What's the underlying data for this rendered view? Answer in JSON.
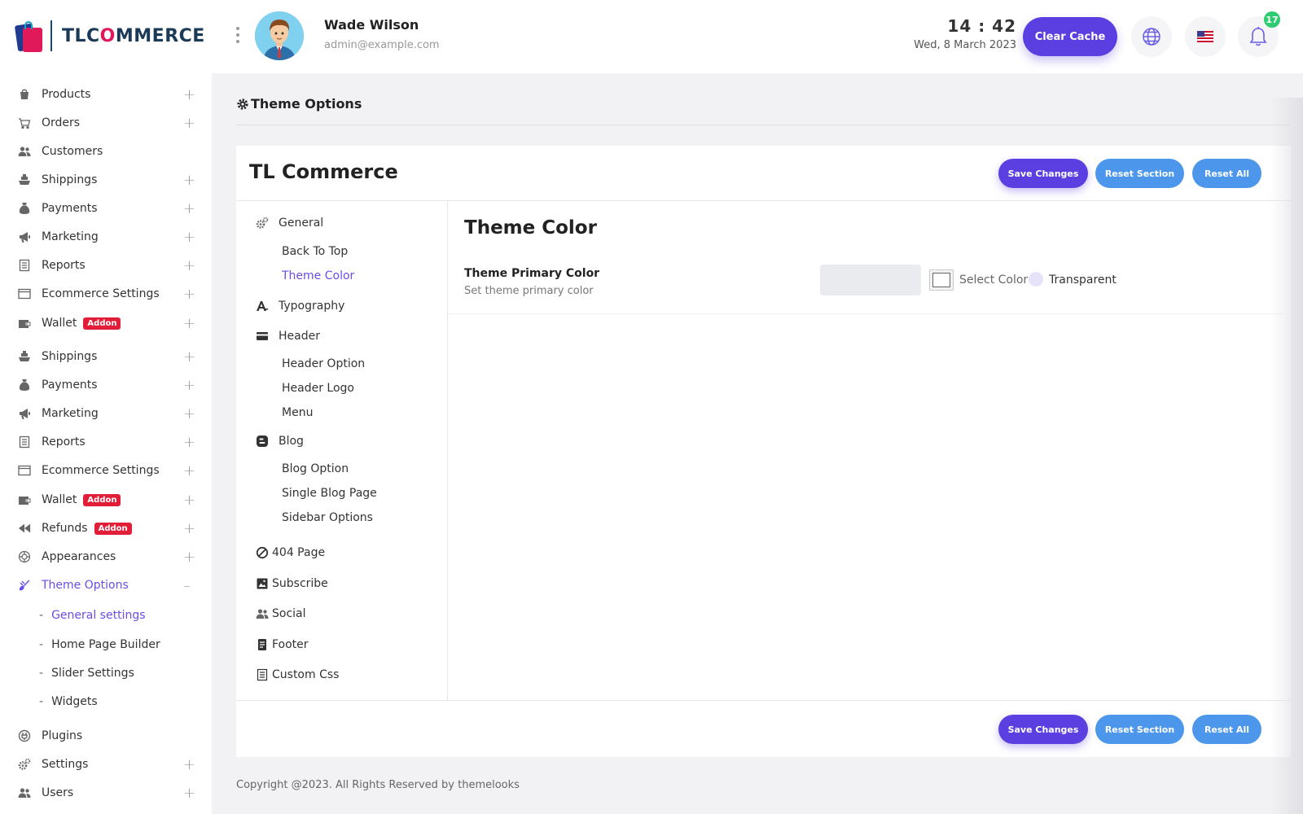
{
  "header": {
    "logo_text_a": "TLC",
    "logo_text_o": "O",
    "logo_text_b": "MMERCE",
    "user_name": "Wade Wilson",
    "user_email": "admin@example.com",
    "time": "14 : 42",
    "date": "Wed, 8 March 2023",
    "clear_cache_label": "Clear Cache",
    "notification_count": "17"
  },
  "sidebar": {
    "items": [
      {
        "label": "Products",
        "icon": "products-icon",
        "expandable": true
      },
      {
        "label": "Orders",
        "icon": "cart-icon",
        "expandable": true
      },
      {
        "label": "Customers",
        "icon": "users-icon",
        "expandable": false
      },
      {
        "label": "Shippings",
        "icon": "ship-icon",
        "expandable": true
      },
      {
        "label": "Payments",
        "icon": "money-bag-icon",
        "expandable": true
      },
      {
        "label": "Marketing",
        "icon": "megaphone-icon",
        "expandable": true
      },
      {
        "label": "Reports",
        "icon": "report-icon",
        "expandable": true
      },
      {
        "label": "Ecommerce Settings",
        "icon": "window-icon",
        "expandable": true
      },
      {
        "label": "Wallet",
        "icon": "wallet-icon",
        "expandable": true,
        "badge": "Addon"
      },
      {
        "label": "Shippings",
        "icon": "ship-icon",
        "expandable": true
      },
      {
        "label": "Payments",
        "icon": "money-bag-icon",
        "expandable": true
      },
      {
        "label": "Marketing",
        "icon": "megaphone-icon",
        "expandable": true
      },
      {
        "label": "Reports",
        "icon": "report-icon",
        "expandable": true
      },
      {
        "label": "Ecommerce Settings",
        "icon": "window-icon",
        "expandable": true
      },
      {
        "label": "Wallet",
        "icon": "wallet-icon",
        "expandable": true,
        "badge": "Addon"
      },
      {
        "label": "Refunds",
        "icon": "rewind-icon",
        "expandable": true,
        "badge": "Addon"
      },
      {
        "label": "Appearances",
        "icon": "palette-icon",
        "expandable": true
      },
      {
        "label": "Theme Options",
        "icon": "brush-icon",
        "expandable": true,
        "active": true,
        "toggle": "–"
      }
    ],
    "theme_subitems": [
      {
        "label": "General settings",
        "active": true
      },
      {
        "label": "Home Page Builder"
      },
      {
        "label": "Slider Settings"
      },
      {
        "label": "Widgets"
      }
    ],
    "bottom_items": [
      {
        "label": "Plugins",
        "icon": "plug-icon",
        "expandable": false
      },
      {
        "label": "Settings",
        "icon": "gears-icon",
        "expandable": true
      },
      {
        "label": "Users",
        "icon": "users-icon",
        "expandable": true
      }
    ],
    "plus": "+",
    "dash": "-"
  },
  "page": {
    "title": "Theme Options",
    "panel_title": "TL Commerce",
    "save_label": "Save Changes",
    "reset_section_label": "Reset Section",
    "reset_all_label": "Reset All"
  },
  "tabs": {
    "groups": [
      {
        "label": "General",
        "icon": "gears-icon",
        "subs": [
          {
            "label": "Back To Top"
          },
          {
            "label": "Theme Color",
            "active": true
          }
        ]
      },
      {
        "label": "Typography",
        "icon": "font-icon",
        "subs": []
      },
      {
        "label": "Header",
        "icon": "card-icon",
        "subs": [
          {
            "label": "Header Option"
          },
          {
            "label": "Header Logo"
          },
          {
            "label": "Menu"
          }
        ]
      },
      {
        "label": "Blog",
        "icon": "blogger-icon",
        "subs": [
          {
            "label": "Blog Option"
          },
          {
            "label": "Single Blog Page"
          },
          {
            "label": "Sidebar Options"
          }
        ]
      },
      {
        "label": "404 Page",
        "icon": "ban-icon",
        "subs": []
      },
      {
        "label": "Subscribe",
        "icon": "image-box-icon",
        "subs": []
      },
      {
        "label": "Social",
        "icon": "users-icon",
        "subs": []
      },
      {
        "label": "Footer",
        "icon": "file-icon",
        "subs": []
      },
      {
        "label": "Custom Css",
        "icon": "code-file-icon",
        "subs": []
      }
    ]
  },
  "content": {
    "title": "Theme Color",
    "field_label": "Theme Primary Color",
    "field_help": "Set theme primary color",
    "select_color": "Select Color",
    "transparent": "Transparent"
  },
  "footer": {
    "copyright": "Copyright @2023. All Rights Reserved by themelooks"
  },
  "colors": {
    "accent": "#5b3fe0",
    "reset": "#4c97ec",
    "active_text": "#6a4ee6",
    "addon": "#e11d38",
    "notif": "#2ecc71"
  }
}
